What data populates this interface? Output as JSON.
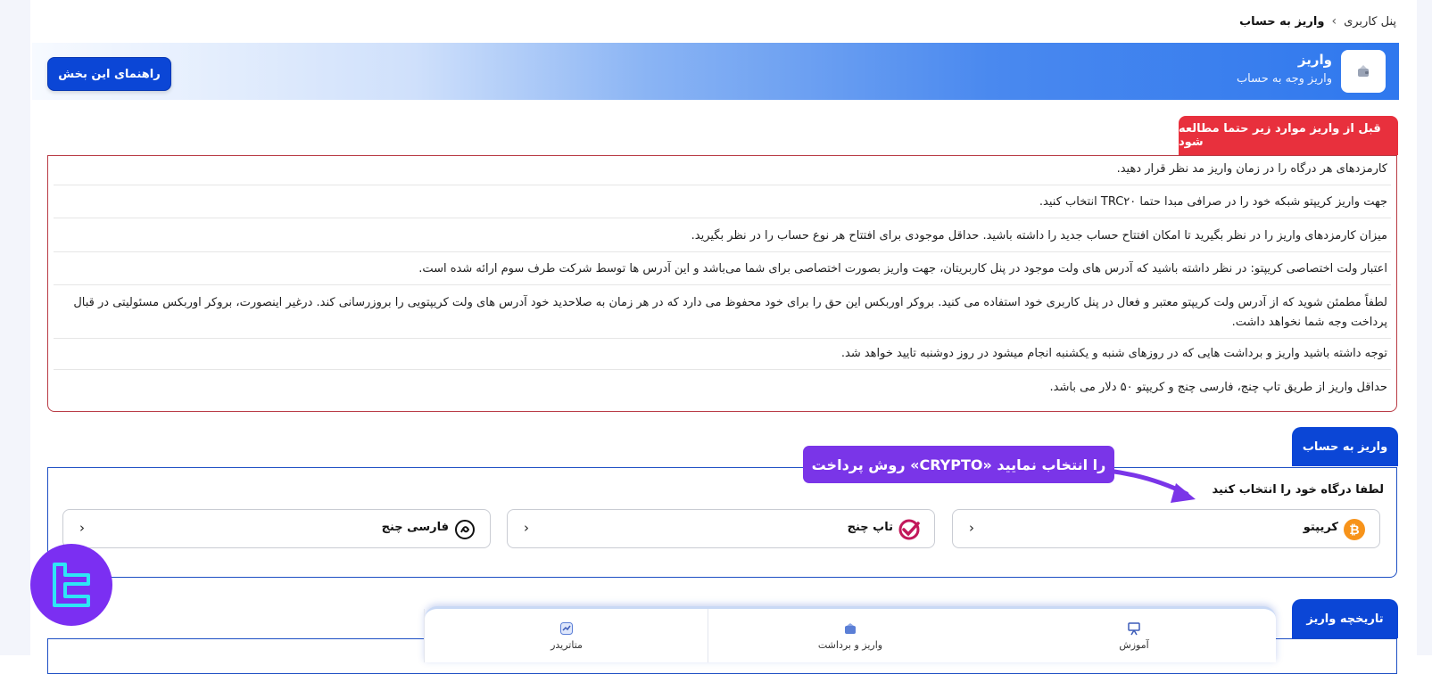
{
  "breadcrumb": {
    "current": "واریز به حساب",
    "parent": "پنل کاربری"
  },
  "header": {
    "title": "واریز",
    "subtitle": "واریز وجه به حساب",
    "guide_button": "راهنمای این بخش",
    "icon": "wallet-icon"
  },
  "notice": {
    "title": "قبل از واریز موارد زیر حتما مطالعه شود",
    "items": [
      "کارمزدهای هر درگاه را در زمان واریز مد نظر قرار دهید.",
      "جهت واریز کریپتو شبکه خود را در صرافی مبدا حتما TRC۲۰ انتخاب کنید.",
      "میزان کارمزدهای واریز را در نظر بگیرید تا امکان افتتاح حساب جدید را داشته باشید. حداقل موجودی برای افتتاح هر نوع حساب را در نظر بگیرید.",
      "اعتبار ولت اختصاصی کریپتو: در نظر داشته باشید که آدرس های ولت موجود در پنل کاربریتان، جهت واریز بصورت اختصاصی برای شما می‌باشد و این آدرس ها توسط شرکت طرف سوم ارائه شده است.",
      "لطفاً مطمئن شوید که از آدرس ولت کریپتو معتبر و فعال در پنل کاربری خود استفاده می کنید. بروکر اوربکس این حق را برای خود محفوظ می دارد که در هر زمان به صلاحدید خود آدرس های ولت کریپتویی را بروزرسانی کند. درغیر اینصورت، بروکر اوربکس مسئولیتی در قبال پرداخت وجه شما نخواهد داشت.",
      "توجه داشته باشید واریز و برداشت هایی که در روزهای شنبه و یکشنبه انجام میشود در روز دوشنبه تایید خواهد شد.",
      "حداقل واریز از طریق تاپ چنج، فارسی چنج و کریپتو ۵۰ دلار می باشد."
    ]
  },
  "deposit": {
    "tab": "واریز به حساب",
    "select_label": "لطفا درگاه خود را انتخاب کنید",
    "callout": "روش پرداخت «CRYPTO» را انتخاب نمایید",
    "gateways": [
      {
        "name": "کریپتو",
        "icon": "bitcoin-icon",
        "color": "#f7931a"
      },
      {
        "name": "تاپ چنج",
        "icon": "topchange-icon",
        "color": "#c2185b"
      },
      {
        "name": "فارسی چنج",
        "icon": "farsichange-icon",
        "color": "#111111"
      }
    ]
  },
  "history": {
    "tab": "تاریخچه واریز"
  },
  "bottom_nav": {
    "items": [
      {
        "label": "آموزش",
        "icon": "presentation-icon"
      },
      {
        "label": "واریز و برداشت",
        "icon": "wallet-icon"
      },
      {
        "label": "متاتریدر",
        "icon": "chart-icon"
      }
    ]
  },
  "colors": {
    "primary": "#0b46d6",
    "danger": "#e8303d",
    "callout": "#7a35e8",
    "logo": "#7b2ff2"
  }
}
